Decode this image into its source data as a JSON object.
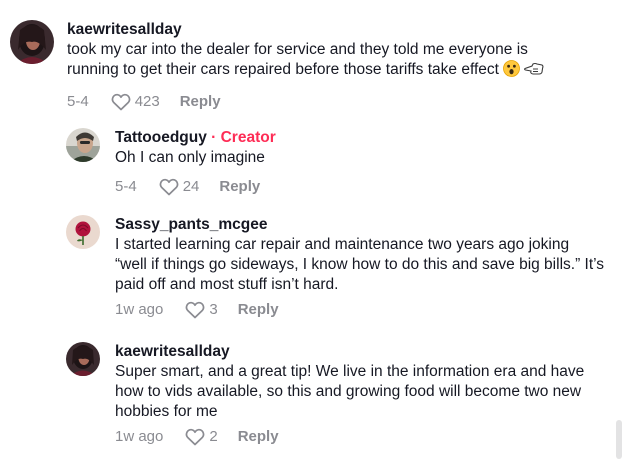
{
  "comments": [
    {
      "username": "kaewritesallday",
      "text": "took my car into the dealer for service and they told me everyone is running to get their cars repaired before those tariffs take effect",
      "emojis": [
        "astonished-face",
        "backhand-index-pointing-left"
      ],
      "time": "5-4",
      "likes": "423",
      "reply_label": "Reply"
    },
    {
      "username": "Tattooedguy",
      "creator_badge": " · Creator",
      "text": "Oh I can only imagine",
      "time": "5-4",
      "likes": "24",
      "reply_label": "Reply"
    },
    {
      "username": "Sassy_pants_mcgee",
      "text": "I started learning car repair and maintenance two years ago joking “well if things go sideways, I know how to do this and save big bills.” It’s paid off and most stuff isn’t hard.",
      "time": "1w ago",
      "likes": "3",
      "reply_label": "Reply"
    },
    {
      "username": "kaewritesallday",
      "text": "Super smart, and a great tip! We live in the information era and have how to vids available, so this and growing food will become two new hobbies for me",
      "time": "1w ago",
      "likes": "2",
      "reply_label": "Reply"
    }
  ],
  "colors": {
    "creator": "#fe2c55",
    "meta": "#8a8b91",
    "text": "#161823"
  }
}
